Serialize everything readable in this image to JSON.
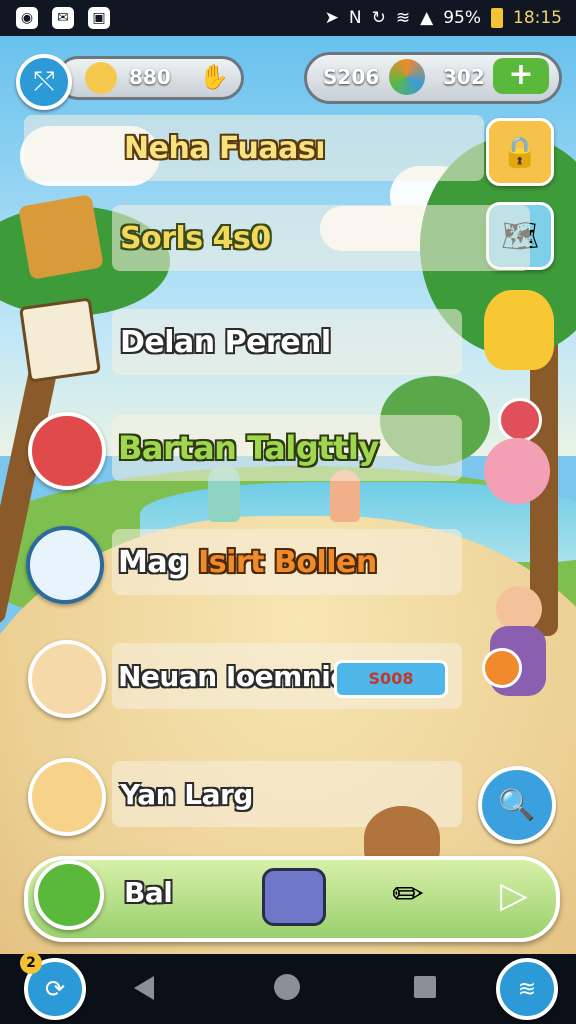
{
  "status_bar": {
    "battery": "95%",
    "time": "18:15"
  },
  "top_bar": {
    "left_count": "880",
    "coins": "S206",
    "gems": "302"
  },
  "menu": {
    "items": [
      {
        "label": "Neha Fuaası",
        "color": "#f6e27f"
      },
      {
        "label": "Sorls 4ѕ0",
        "color": "#f2d95b"
      },
      {
        "label": "Delan Perenl",
        "color": "#ffffff"
      },
      {
        "label": "Bartan Talgttly",
        "color": "#9fd84e"
      },
      {
        "label_a": "Mag",
        "label_b": "Isirt Bollen",
        "color_a": "#ffffff",
        "color_b": "#f08a2b"
      },
      {
        "label": "Neuan Ioemnie",
        "color": "#ffffff",
        "badge": "S008"
      },
      {
        "label": "Yan Larg",
        "color": "#ffffff"
      }
    ]
  },
  "action_bar": {
    "label": "Bal"
  },
  "notification_count": "2",
  "colors": {
    "accent_blue": "#2c9ad6",
    "accent_green": "#5ab83a",
    "badge_blue": "#4fb6ea"
  },
  "icons": [
    "share-icon",
    "plus-icon",
    "back-icon",
    "home-icon",
    "recents-icon",
    "play-icon"
  ]
}
